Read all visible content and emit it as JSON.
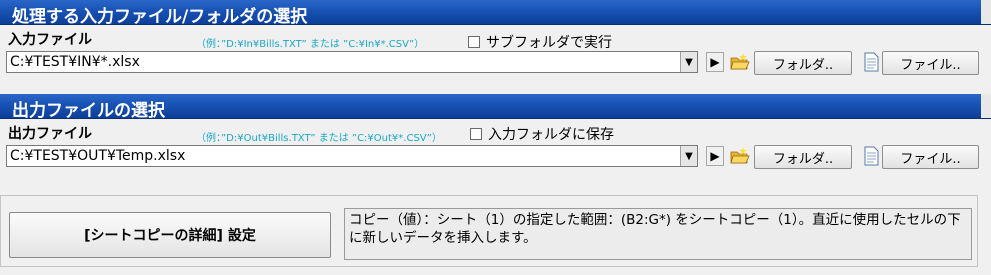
{
  "input_section": {
    "header": "処理する入力ファイル/フォルダの選択",
    "label": "入力ファイル",
    "hint": "（例：”D:¥In¥Bills.TXT” または ”C:¥In¥*.CSV”）",
    "checkbox_label": "サブフォルダで実行",
    "checkbox_checked": false,
    "path_value": "C:¥TEST¥IN¥*.xlsx",
    "run_symbol": "▶",
    "folder_button": "フォルダ..",
    "file_button": "ファイル.."
  },
  "output_section": {
    "header": "出力ファイルの選択",
    "label": "出力ファイル",
    "hint": "（例：”D:¥Out¥Bills.TXT” または ”C:¥Out¥*.CSV”）",
    "checkbox_label": "入力フォルダに保存",
    "checkbox_checked": false,
    "path_value": "C:¥TEST¥OUT¥Temp.xlsx",
    "run_symbol": "▶",
    "folder_button": "フォルダ..",
    "file_button": "ファイル.."
  },
  "settings": {
    "button_label": "[シートコピーの詳細] 設定",
    "description": "コピー（値）：シート（1）の指定した範囲：(B2:G*) をシートコピー（1）。直近に使用したセルの下に新しいデータを挿入します。"
  },
  "colors": {
    "header_band": "#1852b4",
    "hint_text": "#1aa8c8"
  }
}
